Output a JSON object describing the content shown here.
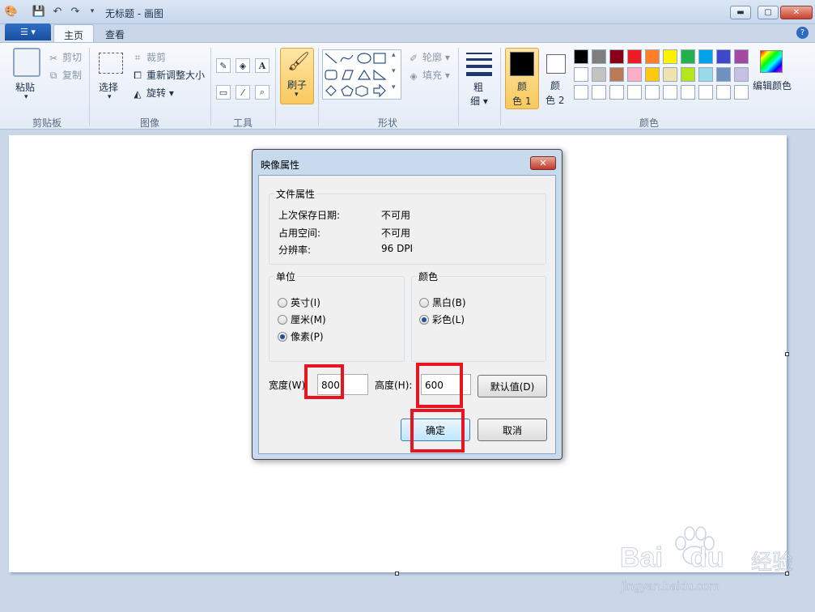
{
  "window": {
    "title": "无标题 - 画图"
  },
  "tabs": [
    {
      "label": "主页"
    },
    {
      "label": "查看"
    }
  ],
  "ribbon": {
    "clipboard": {
      "paste": "粘贴",
      "cut": "剪切",
      "copy": "复制",
      "group": "剪贴板"
    },
    "image": {
      "select": "选择",
      "crop": "裁剪",
      "resize": "重新调整大小",
      "rotate": "旋转",
      "group": "图像"
    },
    "tools": {
      "group": "工具"
    },
    "brush": {
      "label": "刷子"
    },
    "shapes": {
      "outline": "轮廓",
      "fill": "填充",
      "group": "形状"
    },
    "size": {
      "line1": "粗",
      "line2": "细"
    },
    "colors": {
      "color1_a": "颜",
      "color1_b": "色 1",
      "color2_a": "颜",
      "color2_b": "色 2",
      "edit": "编辑颜色",
      "group": "颜色",
      "palette_row1": [
        "#000000",
        "#7f7f7f",
        "#880015",
        "#ed1c24",
        "#ff7f27",
        "#fff200",
        "#22b14c",
        "#00a2e8",
        "#3f48cc",
        "#a349a4"
      ],
      "palette_row2": [
        "#ffffff",
        "#c3c3c3",
        "#b97a57",
        "#ffaec9",
        "#ffc90e",
        "#efe4b0",
        "#b5e61d",
        "#99d9ea",
        "#7092be",
        "#c8bfe7"
      ],
      "palette_row3": [
        "#ffffff",
        "#ffffff",
        "#ffffff",
        "#ffffff",
        "#ffffff",
        "#ffffff",
        "#ffffff",
        "#ffffff",
        "#ffffff",
        "#ffffff"
      ]
    }
  },
  "dialog": {
    "title": "映像属性",
    "file_props": {
      "legend": "文件属性",
      "rows": [
        {
          "label": "上次保存日期:",
          "value": "不可用"
        },
        {
          "label": "占用空间:",
          "value": "不可用"
        },
        {
          "label": "分辨率:",
          "value": "96 DPI"
        }
      ]
    },
    "units": {
      "legend": "单位",
      "options": [
        "英寸(I)",
        "厘米(M)",
        "像素(P)"
      ],
      "selected": "像素(P)"
    },
    "color": {
      "legend": "颜色",
      "options": [
        "黑白(B)",
        "彩色(L)"
      ],
      "selected": "彩色(L)"
    },
    "width": {
      "label": "宽度(W):",
      "value": "800"
    },
    "height": {
      "label": "高度(H):",
      "value": "600"
    },
    "default_btn": "默认值(D)",
    "ok_btn": "确定",
    "cancel_btn": "取消"
  },
  "watermark": {
    "brand": "Bai",
    "brand2": "du",
    "suffix": "经验",
    "url": "jingyan.baidu.com"
  }
}
